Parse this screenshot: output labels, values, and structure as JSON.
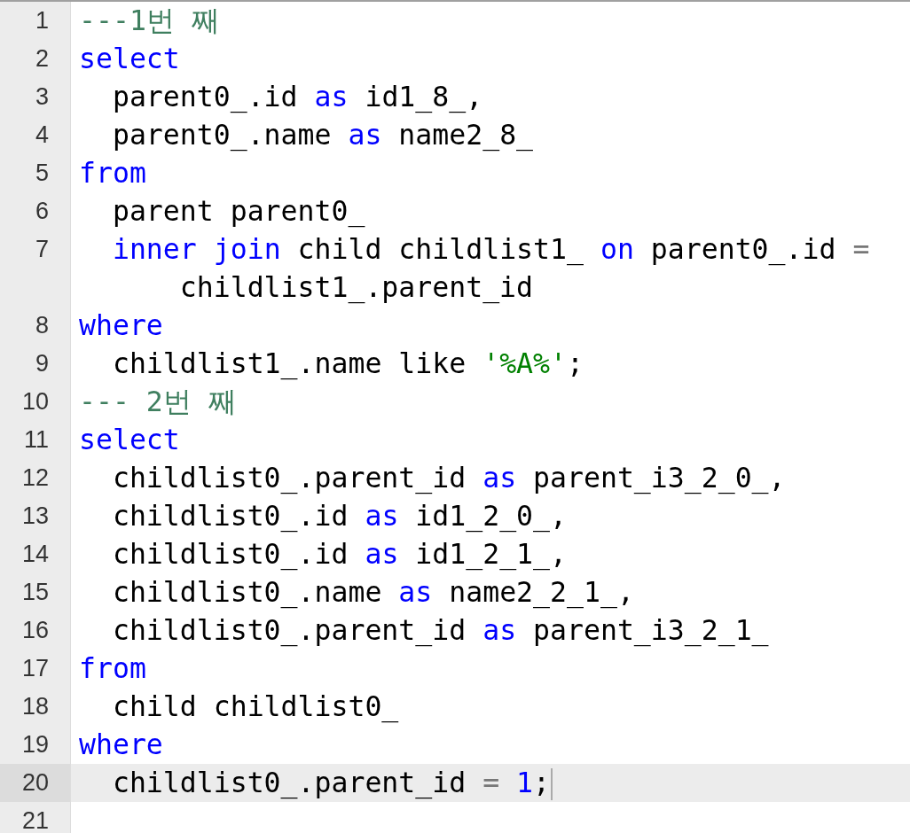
{
  "editor": {
    "lines": [
      {
        "number": "1",
        "active": false,
        "indented": false,
        "tokens": [
          {
            "kind": "comment",
            "text": "---1번 째"
          }
        ]
      },
      {
        "number": "2",
        "active": false,
        "indented": false,
        "tokens": [
          {
            "kind": "keyword",
            "text": "select"
          }
        ]
      },
      {
        "number": "3",
        "active": false,
        "indented": true,
        "tokens": [
          {
            "kind": "plain",
            "text": "parent0_.id "
          },
          {
            "kind": "keyword",
            "text": "as"
          },
          {
            "kind": "plain",
            "text": " id1_8_,"
          }
        ]
      },
      {
        "number": "4",
        "active": false,
        "indented": true,
        "tokens": [
          {
            "kind": "plain",
            "text": "parent0_.name "
          },
          {
            "kind": "keyword",
            "text": "as"
          },
          {
            "kind": "plain",
            "text": " name2_8_"
          }
        ]
      },
      {
        "number": "5",
        "active": false,
        "indented": false,
        "tokens": [
          {
            "kind": "keyword",
            "text": "from"
          }
        ]
      },
      {
        "number": "6",
        "active": false,
        "indented": true,
        "tokens": [
          {
            "kind": "plain",
            "text": "parent parent0_"
          }
        ]
      },
      {
        "number": "7",
        "active": false,
        "indented": true,
        "tokens": [
          {
            "kind": "keyword",
            "text": "inner "
          },
          {
            "kind": "keyword",
            "text": "join"
          },
          {
            "kind": "plain",
            "text": " child childlist1_ "
          },
          {
            "kind": "keyword",
            "text": "on"
          },
          {
            "kind": "plain",
            "text": " parent0_.id "
          },
          {
            "kind": "operator",
            "text": "="
          },
          {
            "kind": "plain",
            "text": " childlist1_.parent_id"
          }
        ]
      },
      {
        "number": "8",
        "active": false,
        "indented": false,
        "tokens": [
          {
            "kind": "keyword",
            "text": "where"
          }
        ]
      },
      {
        "number": "9",
        "active": false,
        "indented": true,
        "tokens": [
          {
            "kind": "plain",
            "text": "childlist1_.name like "
          },
          {
            "kind": "string",
            "text": "'%A%'"
          },
          {
            "kind": "plain",
            "text": ";"
          }
        ]
      },
      {
        "number": "10",
        "active": false,
        "indented": false,
        "tokens": [
          {
            "kind": "comment",
            "text": "--- 2번 째"
          }
        ]
      },
      {
        "number": "11",
        "active": false,
        "indented": false,
        "tokens": [
          {
            "kind": "keyword",
            "text": "select"
          }
        ]
      },
      {
        "number": "12",
        "active": false,
        "indented": true,
        "tokens": [
          {
            "kind": "plain",
            "text": "childlist0_.parent_id "
          },
          {
            "kind": "keyword",
            "text": "as"
          },
          {
            "kind": "plain",
            "text": " parent_i3_2_0_,"
          }
        ]
      },
      {
        "number": "13",
        "active": false,
        "indented": true,
        "tokens": [
          {
            "kind": "plain",
            "text": "childlist0_.id "
          },
          {
            "kind": "keyword",
            "text": "as"
          },
          {
            "kind": "plain",
            "text": " id1_2_0_,"
          }
        ]
      },
      {
        "number": "14",
        "active": false,
        "indented": true,
        "tokens": [
          {
            "kind": "plain",
            "text": "childlist0_.id "
          },
          {
            "kind": "keyword",
            "text": "as"
          },
          {
            "kind": "plain",
            "text": " id1_2_1_,"
          }
        ]
      },
      {
        "number": "15",
        "active": false,
        "indented": true,
        "tokens": [
          {
            "kind": "plain",
            "text": "childlist0_.name "
          },
          {
            "kind": "keyword",
            "text": "as"
          },
          {
            "kind": "plain",
            "text": " name2_2_1_,"
          }
        ]
      },
      {
        "number": "16",
        "active": false,
        "indented": true,
        "tokens": [
          {
            "kind": "plain",
            "text": "childlist0_.parent_id "
          },
          {
            "kind": "keyword",
            "text": "as"
          },
          {
            "kind": "plain",
            "text": " parent_i3_2_1_"
          }
        ]
      },
      {
        "number": "17",
        "active": false,
        "indented": false,
        "tokens": [
          {
            "kind": "keyword",
            "text": "from"
          }
        ]
      },
      {
        "number": "18",
        "active": false,
        "indented": true,
        "tokens": [
          {
            "kind": "plain",
            "text": "child childlist0_"
          }
        ]
      },
      {
        "number": "19",
        "active": false,
        "indented": false,
        "tokens": [
          {
            "kind": "keyword",
            "text": "where"
          }
        ]
      },
      {
        "number": "20",
        "active": true,
        "indented": true,
        "tokens": [
          {
            "kind": "plain",
            "text": "childlist0_.parent_id "
          },
          {
            "kind": "operator",
            "text": "= "
          },
          {
            "kind": "number",
            "text": "1"
          },
          {
            "kind": "plain",
            "text": ";"
          }
        ]
      },
      {
        "number": "21",
        "active": false
      }
    ]
  }
}
